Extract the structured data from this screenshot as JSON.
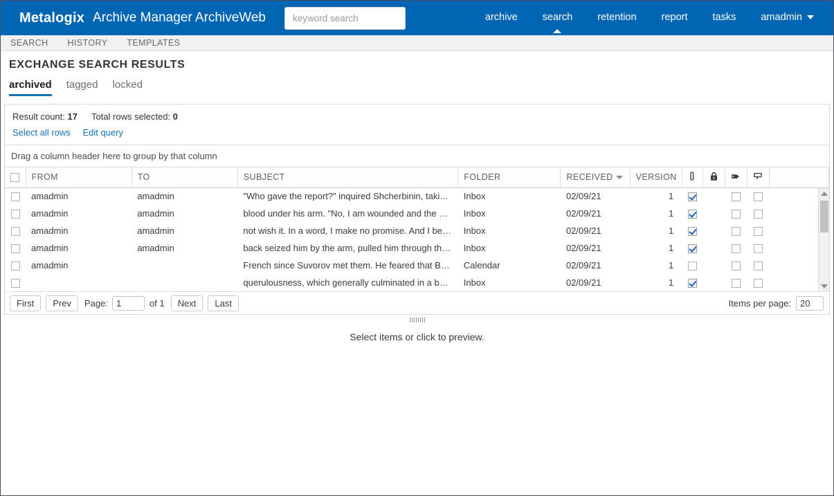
{
  "header": {
    "brand": "Metalogix",
    "app_title": "Archive Manager ArchiveWeb",
    "search_placeholder": "keyword search",
    "search_value": "",
    "accent_color": "#0065b3",
    "nav": [
      {
        "label": "archive",
        "active": false
      },
      {
        "label": "search",
        "active": true
      },
      {
        "label": "retention",
        "active": false
      },
      {
        "label": "report",
        "active": false
      },
      {
        "label": "tasks",
        "active": false
      },
      {
        "label": "amadmin",
        "active": false,
        "has_caret": true
      }
    ]
  },
  "subnav": {
    "items": [
      {
        "label": "SEARCH"
      },
      {
        "label": "HISTORY"
      },
      {
        "label": "TEMPLATES"
      }
    ]
  },
  "page": {
    "title": "EXCHANGE SEARCH RESULTS"
  },
  "state_tabs": [
    {
      "label": "archived",
      "active": true
    },
    {
      "label": "tagged",
      "active": false
    },
    {
      "label": "locked",
      "active": false
    }
  ],
  "results": {
    "count_label": "Result count:",
    "count_value": "17",
    "selected_label": "Total rows selected:",
    "selected_value": "0",
    "select_all_label": "Select all rows",
    "edit_query_label": "Edit query",
    "group_hint": "Drag a column header here to group by that column"
  },
  "grid": {
    "columns": [
      {
        "key": "check",
        "label": "",
        "type": "checkbox"
      },
      {
        "key": "from",
        "label": "FROM",
        "type": "text"
      },
      {
        "key": "to",
        "label": "TO",
        "type": "text"
      },
      {
        "key": "subject",
        "label": "SUBJECT",
        "type": "text"
      },
      {
        "key": "folder",
        "label": "FOLDER",
        "type": "text"
      },
      {
        "key": "received",
        "label": "RECEIVED",
        "type": "text",
        "sorted": "desc"
      },
      {
        "key": "version",
        "label": "VERSION",
        "type": "text"
      },
      {
        "key": "attachment",
        "label": "",
        "type": "icon",
        "icon": "paperclip-icon"
      },
      {
        "key": "locked",
        "label": "",
        "type": "icon",
        "icon": "lock-icon"
      },
      {
        "key": "tag",
        "label": "",
        "type": "icon",
        "icon": "tag-icon"
      },
      {
        "key": "note",
        "label": "",
        "type": "icon",
        "icon": "comment-icon"
      },
      {
        "key": "spacer",
        "label": "",
        "type": "spacer"
      }
    ],
    "rows": [
      {
        "selected": false,
        "from": "amadmin",
        "to": "amadmin",
        "subject": "\"Who gave the report?\" inquired Shcherbinin, taking the ...",
        "folder": "Inbox",
        "received": "02/09/21",
        "version": "1",
        "attachment": true,
        "locked": null,
        "tag": false,
        "note": false
      },
      {
        "selected": false,
        "from": "amadmin",
        "to": "amadmin",
        "subject": "blood under his arm. \"No, I am wounded and the horse i...",
        "folder": "Inbox",
        "received": "02/09/21",
        "version": "1",
        "attachment": true,
        "locked": null,
        "tag": false,
        "note": false
      },
      {
        "selected": false,
        "from": "amadmin",
        "to": "amadmin",
        "subject": "not wish it. In a word, I make no promise. And I beg you ...",
        "folder": "Inbox",
        "received": "02/09/21",
        "version": "1",
        "attachment": true,
        "locked": null,
        "tag": false,
        "note": false
      },
      {
        "selected": false,
        "from": "amadmin",
        "to": "amadmin",
        "subject": "back seized him by the arm, pulled him through the wic...",
        "folder": "Inbox",
        "received": "02/09/21",
        "version": "1",
        "attachment": true,
        "locked": null,
        "tag": false,
        "note": false
      },
      {
        "selected": false,
        "from": "amadmin",
        "to": "",
        "subject": "French since Suvorov met them. He feared that Bonapart...",
        "folder": "Calendar",
        "received": "02/09/21",
        "version": "1",
        "attachment": false,
        "locked": null,
        "tag": false,
        "note": false
      },
      {
        "selected": false,
        "from": "",
        "to": "",
        "subject": "querulousness, which generally culminated in a burst of ...",
        "folder": "Inbox",
        "received": "02/09/21",
        "version": "1",
        "attachment": true,
        "locked": null,
        "tag": false,
        "note": false
      }
    ]
  },
  "pager": {
    "first": "First",
    "prev": "Prev",
    "page_label": "Page:",
    "page_value": "1",
    "of_label": "of 1",
    "next": "Next",
    "last": "Last",
    "items_per_page_label": "Items per page:",
    "items_per_page_value": "20"
  },
  "preview": {
    "message": "Select items or click to preview."
  }
}
